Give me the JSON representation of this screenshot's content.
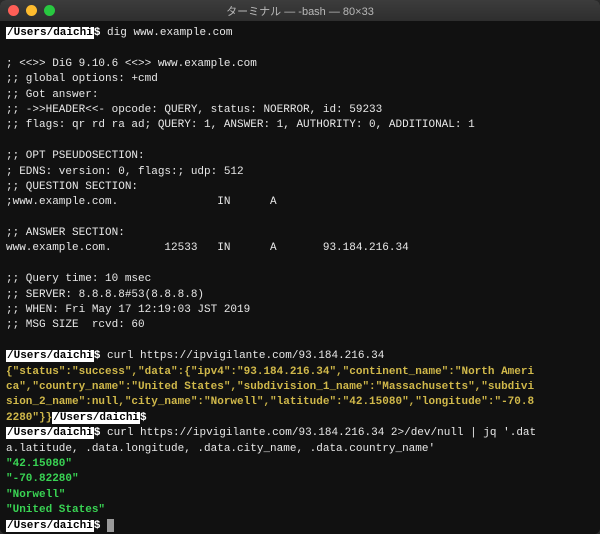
{
  "title": "ターミナル — -bash — 80×33",
  "prompt_path": "/Users/daichi",
  "prompt_symbol": "$",
  "cmd1": "dig www.example.com",
  "dig": {
    "l1": "",
    "l2": "; <<>> DiG 9.10.6 <<>> www.example.com",
    "l3": ";; global options: +cmd",
    "l4": ";; Got answer:",
    "l5": ";; ->>HEADER<<- opcode: QUERY, status: NOERROR, id: 59233",
    "l6": ";; flags: qr rd ra ad; QUERY: 1, ANSWER: 1, AUTHORITY: 0, ADDITIONAL: 1",
    "l7": "",
    "l8": ";; OPT PSEUDOSECTION:",
    "l9": "; EDNS: version: 0, flags:; udp: 512",
    "l10": ";; QUESTION SECTION:",
    "l11": ";www.example.com.               IN      A",
    "l12": "",
    "l13": ";; ANSWER SECTION:",
    "l14": "www.example.com.        12533   IN      A       93.184.216.34",
    "l15": "",
    "l16": ";; Query time: 10 msec",
    "l17": ";; SERVER: 8.8.8.8#53(8.8.8.8)",
    "l18": ";; WHEN: Fri May 17 12:19:03 JST 2019",
    "l19": ";; MSG SIZE  rcvd: 60",
    "l20": ""
  },
  "cmd2": "curl https://ipvigilante.com/93.184.216.34",
  "curl_json_l1": "{\"status\":\"success\",\"data\":{\"ipv4\":\"93.184.216.34\",\"continent_name\":\"North Ameri",
  "curl_json_l2": "ca\",\"country_name\":\"United States\",\"subdivision_1_name\":\"Massachusetts\",\"subdivi",
  "curl_json_l3": "sion_2_name\":null,\"city_name\":\"Norwell\",\"latitude\":\"42.15080\",\"longitude\":\"-70.8",
  "curl_json_l4_a": "2280\"}}",
  "cmd3_l1": "curl https://ipvigilante.com/93.184.216.34 2>/dev/null | jq '.dat",
  "cmd3_l2": "a.latitude, .data.longitude, .data.city_name, .data.country_name'",
  "jq": {
    "lat": "\"42.15080\"",
    "lon": "\"-70.82280\"",
    "city": "\"Norwell\"",
    "country": "\"United States\""
  }
}
